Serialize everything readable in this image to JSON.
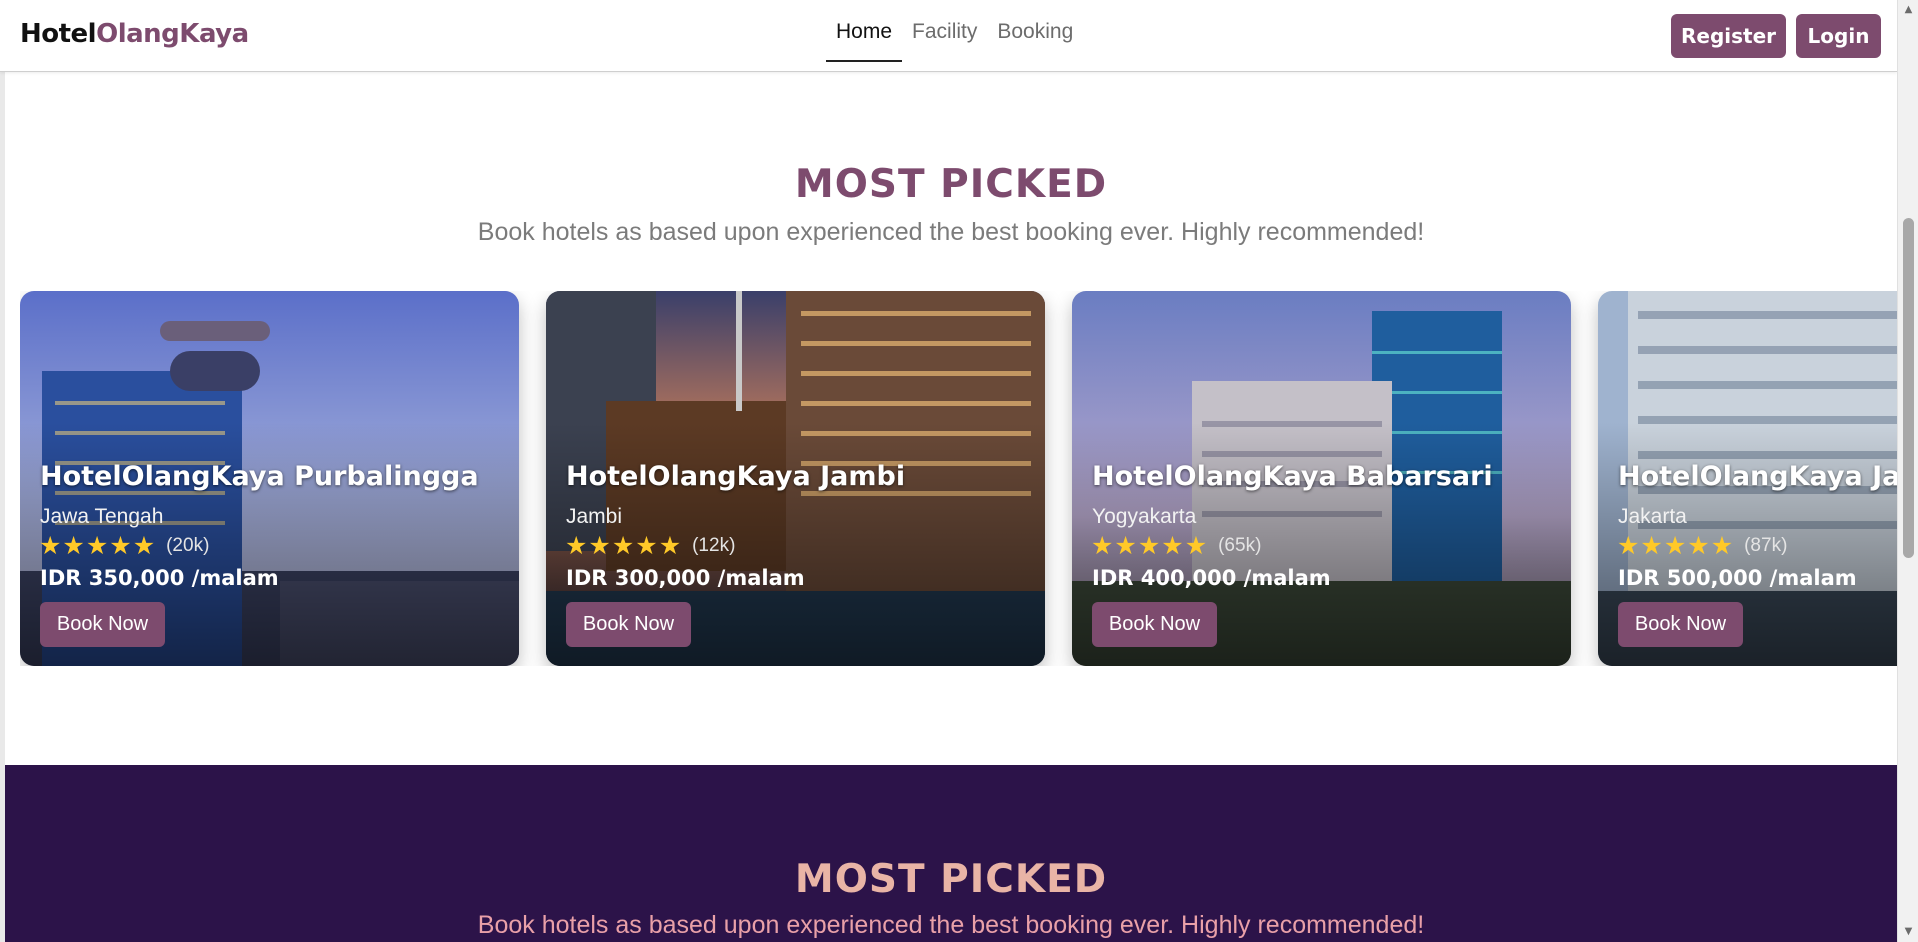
{
  "navbar": {
    "brand_part1": "Hotel",
    "brand_part2": "OlangKaya",
    "links": [
      {
        "label": "Home",
        "active": true
      },
      {
        "label": "Facility",
        "active": false
      },
      {
        "label": "Booking",
        "active": false
      }
    ],
    "register_label": "Register",
    "login_label": "Login"
  },
  "most_picked": {
    "title": "MOST PICKED",
    "subtitle": "Book hotels as based upon experienced the best booking ever. Highly recommended!",
    "cards": [
      {
        "name": "HotelOlangKaya Purbalingga",
        "location": "Jawa Tengah",
        "stars": 5,
        "reviews": "(20k)",
        "price": "IDR 350,000 /malam",
        "button": "Book Now"
      },
      {
        "name": "HotelOlangKaya Jambi",
        "location": "Jambi",
        "stars": 5,
        "reviews": "(12k)",
        "price": "IDR 300,000 /malam",
        "button": "Book Now"
      },
      {
        "name": "HotelOlangKaya Babarsari",
        "location": "Yogyakarta",
        "stars": 5,
        "reviews": "(65k)",
        "price": "IDR 400,000 /malam",
        "button": "Book Now"
      },
      {
        "name": "HotelOlangKaya Jakarta",
        "location": "Jakarta",
        "stars": 5,
        "reviews": "(87k)",
        "price": "IDR 500,000 /malam",
        "button": "Book Now"
      }
    ]
  },
  "section2": {
    "title": "MOST PICKED",
    "subtitle": "Book hotels as based upon experienced the best booking ever. Highly recommended!"
  },
  "colors": {
    "brand_accent": "#7d4b6e",
    "dark_section_bg": "#2c1349",
    "dark_section_title": "#e9b4a6",
    "star": "#ffc928"
  },
  "icons": {
    "star": "star-icon",
    "scroll_up": "scroll-up-arrow-icon",
    "scroll_down": "scroll-down-arrow-icon"
  }
}
